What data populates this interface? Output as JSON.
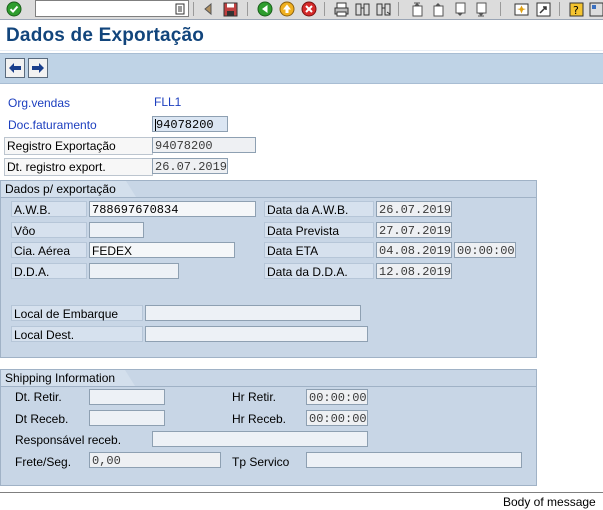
{
  "toolbar": {
    "command_field": "",
    "icons": [
      "enter-icon",
      "command-field-icon",
      "back-icon",
      "save-icon",
      "back-nav-icon",
      "exit-icon",
      "cancel-icon",
      "print-icon",
      "find-icon",
      "find-next-icon",
      "first-page-icon",
      "previous-page-icon",
      "next-page-icon",
      "last-page-icon",
      "create-session-icon",
      "shortcut-icon",
      "help-icon"
    ]
  },
  "title": "Dados de Exportação",
  "header": {
    "org_vendas_label": "Org.vendas",
    "org_vendas_value": "FLL1",
    "doc_fat_label": "Doc.faturamento",
    "doc_fat_value": "94078200",
    "registro_label": "Registro Exportação",
    "registro_value": "94078200",
    "dt_registro_label": "Dt. registro export.",
    "dt_registro_value": "26.07.2019"
  },
  "export_group": {
    "title": "Dados p/ exportação",
    "awb_label": "A.W.B.",
    "awb_value": "788697670834",
    "voo_label": "Vôo",
    "voo_value": "",
    "cia_label": "Cia. Aérea",
    "cia_value": "FEDEX",
    "dda_label": "D.D.A.",
    "dda_value": "",
    "data_awb_label": "Data da A.W.B.",
    "data_awb_value": "26.07.2019",
    "data_prevista_label": "Data Prevista",
    "data_prevista_value": "27.07.2019",
    "data_eta_label": "Data ETA",
    "data_eta_value": "04.08.2019",
    "hora_eta_value": "00:00:00",
    "data_dda_label": "Data da D.D.A.",
    "data_dda_value": "12.08.2019",
    "local_embarque_label": "Local de Embarque",
    "local_embarque_value": "",
    "local_dest_label": "Local Dest.",
    "local_dest_value": ""
  },
  "shipping_group": {
    "title": "Shipping Information",
    "dt_retir_label": "Dt. Retir.",
    "dt_retir_value": "",
    "hr_retir_label": "Hr Retir.",
    "hr_retir_value": "00:00:00",
    "dt_receb_label": "Dt Receb.",
    "dt_receb_value": "",
    "hr_receb_label": "Hr Receb.",
    "hr_receb_value": "00:00:00",
    "responsavel_label": "Responsável receb.",
    "responsavel_value": "",
    "frete_label": "Frete/Seg.",
    "frete_value": "0,00",
    "tp_servico_label": "Tp Servico",
    "tp_servico_value": ""
  },
  "status_bar": {
    "text": "Body of message"
  }
}
